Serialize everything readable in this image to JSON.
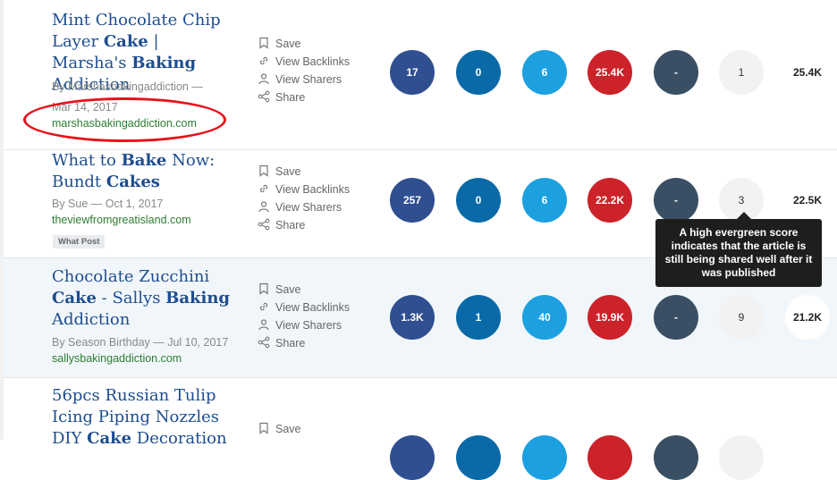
{
  "actions": {
    "save": "Save",
    "backlinks": "View Backlinks",
    "sharers": "View Sharers",
    "share": "Share"
  },
  "rows": [
    {
      "title": [
        {
          "t": "Mint Chocolate Chip Layer ",
          "b": false
        },
        {
          "t": "Cake",
          "b": true
        },
        {
          "t": " | Marsha's ",
          "b": false
        },
        {
          "t": "Baking",
          "b": true
        },
        {
          "t": " Addiction",
          "b": false
        }
      ],
      "author_line": "By Marshasbakingaddiction —",
      "date_line": "Mar 14, 2017",
      "domain": "marshasbakingaddiction.com",
      "facebook": "17",
      "linkedin": "0",
      "twitter": "6",
      "pinterest": "25.4K",
      "reddit": "-",
      "evergreen": "1",
      "total": "25.4K"
    },
    {
      "title": [
        {
          "t": "What to ",
          "b": false
        },
        {
          "t": "Bake",
          "b": true
        },
        {
          "t": " Now: Bundt ",
          "b": false
        },
        {
          "t": "Cakes",
          "b": true
        }
      ],
      "meta": "By Sue — Oct 1, 2017",
      "domain": "theviewfromgreatisland.com",
      "tag": "What Post",
      "facebook": "257",
      "linkedin": "0",
      "twitter": "6",
      "pinterest": "22.2K",
      "reddit": "-",
      "evergreen": "3",
      "total": "22.5K"
    },
    {
      "title": [
        {
          "t": "Chocolate Zucchini ",
          "b": false
        },
        {
          "t": "Cake",
          "b": true
        },
        {
          "t": " - Sallys ",
          "b": false
        },
        {
          "t": "Baking",
          "b": true
        },
        {
          "t": " Addiction",
          "b": false
        }
      ],
      "meta": "By Season Birthday — Jul 10, 2017",
      "domain": "sallysbakingaddiction.com",
      "facebook": "1.3K",
      "linkedin": "1",
      "twitter": "40",
      "pinterest": "19.9K",
      "reddit": "-",
      "evergreen": "9",
      "total": "21.2K"
    },
    {
      "title": [
        {
          "t": "56pcs Russian Tulip Icing Piping Nozzles DIY ",
          "b": false
        },
        {
          "t": "Cake",
          "b": true
        },
        {
          "t": " Decoration",
          "b": false
        }
      ]
    }
  ],
  "tooltip": "A high evergreen score indicates that the article is still being shared well after it was published",
  "colors": {
    "facebook": "#2f4f90",
    "linkedin": "#0a6aa8",
    "twitter": "#1da0e0",
    "pinterest": "#cc2229",
    "reddit": "#3a4f63",
    "title": "#1e4d8f",
    "domain": "#2e7d32",
    "highlight_oval": "#e5121b"
  }
}
